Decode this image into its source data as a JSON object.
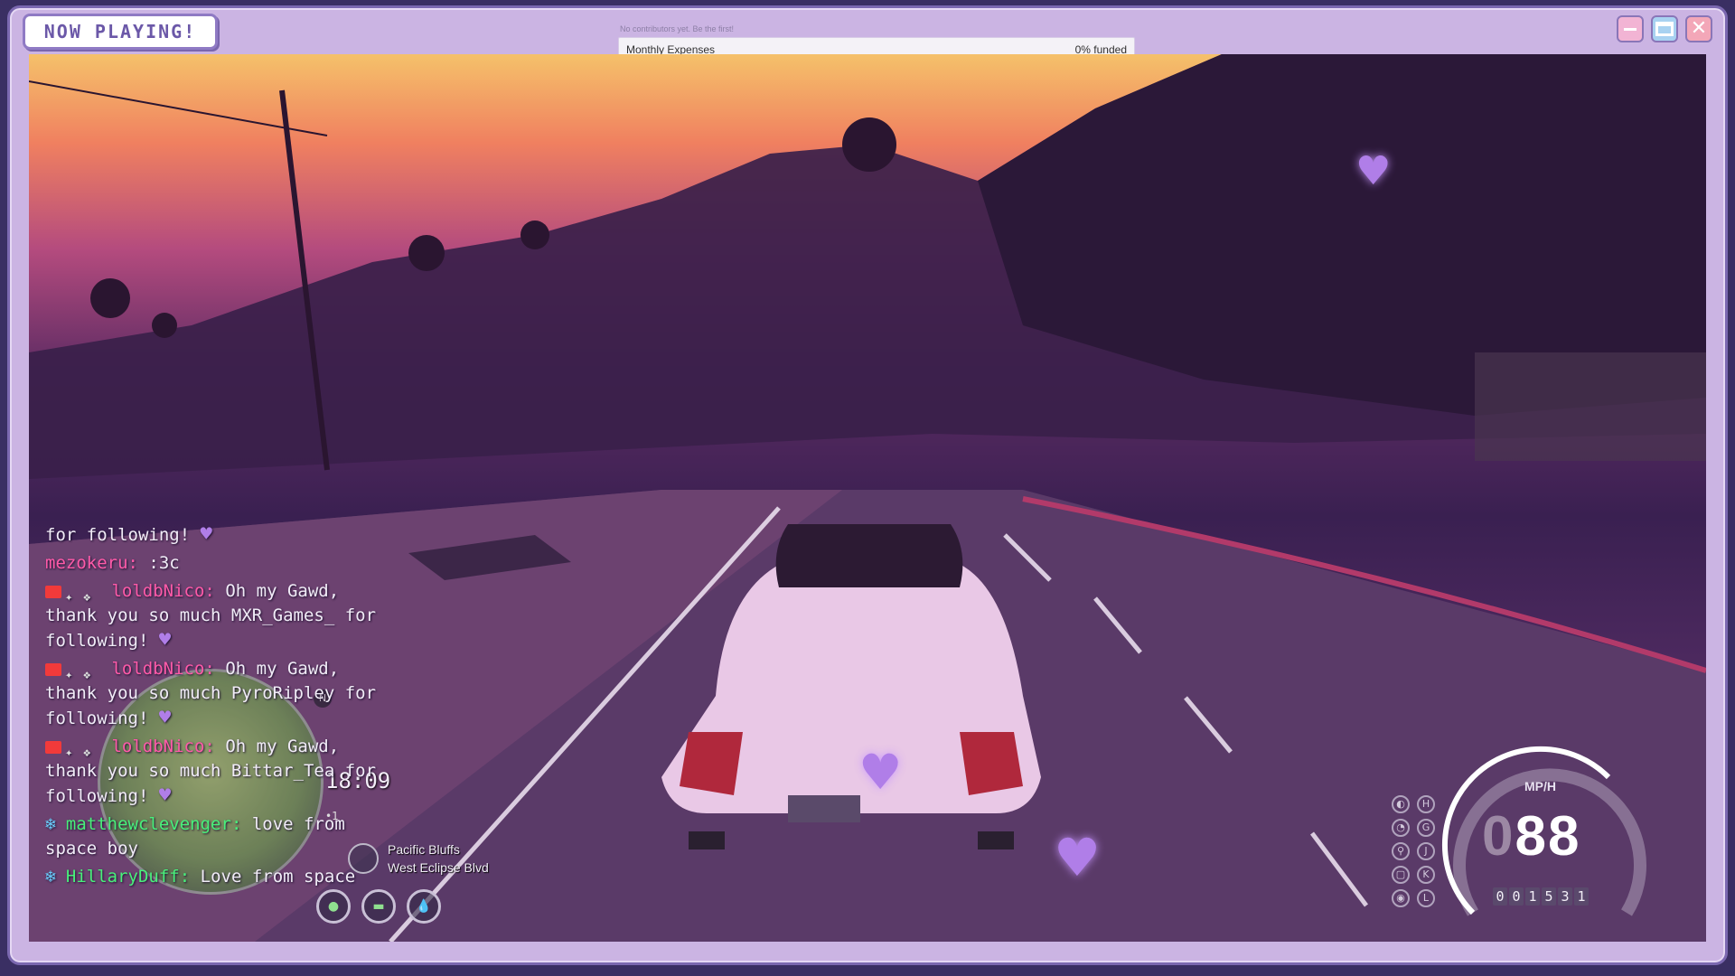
{
  "window": {
    "now_playing_label": "NOW PLAYING!",
    "controls": [
      "minimize",
      "maximize",
      "close"
    ],
    "close_symbol": "✕"
  },
  "goal": {
    "caption": "No contributors yet. Be the first!",
    "title": "Monthly Expenses",
    "status": "0% funded",
    "progress": 0
  },
  "chat": {
    "top_partial": "for following!",
    "messages": [
      {
        "user": "mezokeru",
        "sep": ":",
        "text": ":3c",
        "badges": []
      },
      {
        "user": "loldbNico",
        "sep": ":",
        "text": "Oh my Gawd, thank you so much MXR_Games_ for following!",
        "badges": [
          "broadcaster",
          "verified",
          "sub"
        ]
      },
      {
        "user": "loldbNico",
        "sep": ":",
        "text": "Oh my Gawd, thank you so much PyroRipley for following!",
        "badges": [
          "broadcaster",
          "verified",
          "sub"
        ]
      },
      {
        "user": "loldbNico",
        "sep": ":",
        "text": "Oh my Gawd, thank you so much Bittar_Tea for following!",
        "badges": [
          "broadcaster",
          "verified",
          "sub"
        ]
      },
      {
        "user": "matthewclevenger",
        "sep": ":",
        "text": "love from space boy",
        "badges": [
          "star"
        ]
      },
      {
        "user": "HillaryDuff",
        "sep": ":",
        "text": "Love from space",
        "badges": [
          "star"
        ]
      }
    ]
  },
  "hud": {
    "clock": "18:09",
    "clock_sub": "•1",
    "minimap_north": "N",
    "location_area": "Pacific Bluffs",
    "location_street": "West Eclipse Blvd",
    "speed_unit": "MP/H",
    "speed_prefix": "0",
    "speed": "88",
    "odometer": [
      "0",
      "0",
      "1",
      "5",
      "3",
      "1"
    ],
    "gear_icons": [
      "H",
      "G",
      "J",
      "K",
      "L"
    ]
  },
  "colors": {
    "accent": "#8f7ac4",
    "heart": "#b07ee8",
    "chat_user_pink": "#ff5aa8",
    "chat_user_green": "#48f07a"
  }
}
